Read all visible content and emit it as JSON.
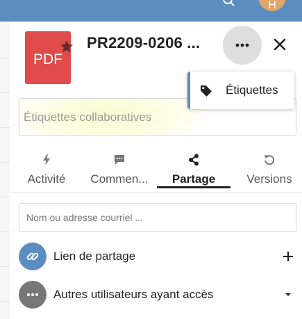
{
  "header": {
    "avatar_initial": "H"
  },
  "file": {
    "type_label": "PDF",
    "title": "PR2209-0206 ...",
    "icon_color": "#e04b4b"
  },
  "menu": {
    "tags_item": "Étiquettes"
  },
  "tags_field": {
    "placeholder": "Étiquettes collaboratives"
  },
  "tabs": [
    {
      "label": "Activité",
      "icon": "bolt-icon"
    },
    {
      "label": "Commen...",
      "icon": "comment-icon"
    },
    {
      "label": "Partage",
      "icon": "share-icon",
      "active": true
    },
    {
      "label": "Versions",
      "icon": "history-icon"
    }
  ],
  "sharing": {
    "input_placeholder": "Nom ou adresse courriel ...",
    "link_label": "Lien de partage",
    "others_label": "Autres utilisateurs ayant accès"
  },
  "colors": {
    "accent": "#5b8dc0",
    "link_circle": "#5b8dc0",
    "others_circle": "#777777"
  }
}
